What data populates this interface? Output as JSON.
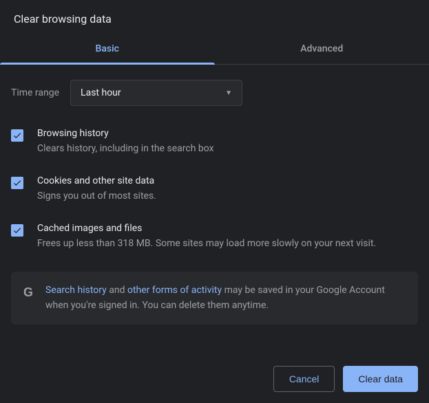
{
  "title": "Clear browsing data",
  "tabs": {
    "basic": "Basic",
    "advanced": "Advanced"
  },
  "timeRange": {
    "label": "Time range",
    "value": "Last hour"
  },
  "options": [
    {
      "title": "Browsing history",
      "desc": "Clears history, including in the search box"
    },
    {
      "title": "Cookies and other site data",
      "desc": "Signs you out of most sites."
    },
    {
      "title": "Cached images and files",
      "desc": "Frees up less than 318 MB. Some sites may load more slowly on your next visit."
    }
  ],
  "info": {
    "link1": "Search history",
    "mid1": " and ",
    "link2": "other forms of activity",
    "rest": " may be saved in your Google Account when you're signed in. You can delete them anytime."
  },
  "buttons": {
    "cancel": "Cancel",
    "clear": "Clear data"
  }
}
